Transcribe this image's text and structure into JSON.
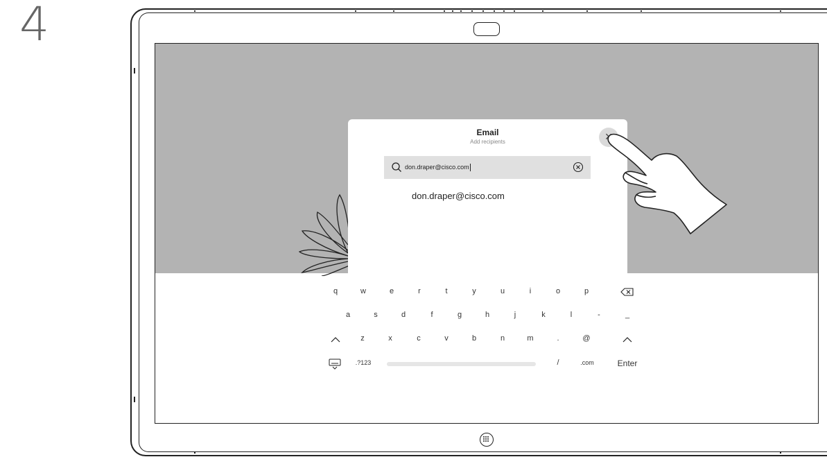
{
  "step_number": "4",
  "dialog": {
    "title": "Email",
    "subtitle": "Add recipients",
    "close_symbol": "×",
    "search_value": "don.draper@cisco.com",
    "suggestion": "don.draper@cisco.com"
  },
  "keyboard": {
    "row1": [
      "q",
      "w",
      "e",
      "r",
      "t",
      "y",
      "u",
      "i",
      "o",
      "p"
    ],
    "row2": [
      "a",
      "s",
      "d",
      "f",
      "g",
      "h",
      "j",
      "k",
      "l",
      "-",
      "_"
    ],
    "row3": [
      "z",
      "x",
      "c",
      "v",
      "b",
      "n",
      "m",
      ".",
      "@"
    ],
    "numeric_label": ".?123",
    "slash": "/",
    "dotcom": ".com",
    "enter": "Enter"
  },
  "icons": {
    "close": "close-icon",
    "search": "search-icon",
    "clear": "clear-icon",
    "backspace": "backspace-icon",
    "shift": "shift-icon",
    "hide_keyboard": "keyboard-hide-icon",
    "home": "home-button-icon",
    "camera": "camera-icon",
    "hand": "hand-pointer-icon"
  },
  "colors": {
    "background_gray": "#b3b3b3",
    "search_field": "#e0e0e0",
    "close_button": "#dadada"
  }
}
